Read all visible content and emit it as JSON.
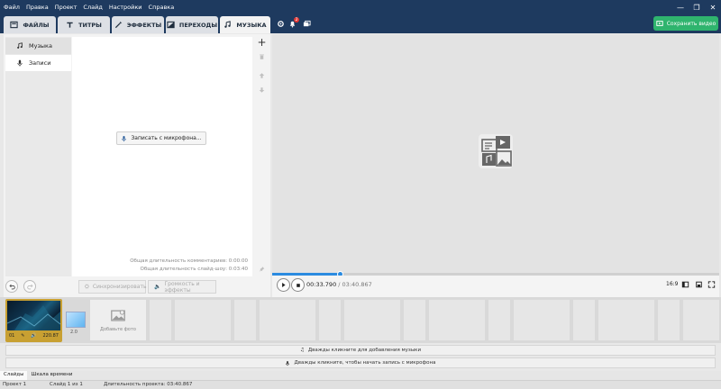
{
  "menu": [
    "Файл",
    "Правка",
    "Проект",
    "Слайд",
    "Настройки",
    "Справка"
  ],
  "tabs": {
    "files": "ФАЙЛЫ",
    "titles": "ТИТРЫ",
    "effects": "ЭФФЕКТЫ",
    "transitions": "ПЕРЕХОДЫ",
    "music": "МУЗЫКА"
  },
  "notifications_count": "2",
  "save_label": "Сохранить видео",
  "sidebar": {
    "music": "Музыка",
    "records": "Записи"
  },
  "record_button": "Записать с микрофона...",
  "durations": {
    "comments": "Общая длительность комментариев: 0:00:00",
    "slideshow": "Общая длительность слайд-шоу: 0:03:40"
  },
  "bottom_tools": {
    "sync": "Синхронизировать",
    "volume": "Громкость и эффекты"
  },
  "player": {
    "current_time": "00:33.790",
    "separator": " / ",
    "total_time": "03:40.867",
    "aspect_ratio": "16:9",
    "progress": 0.153
  },
  "timeline": {
    "slide_number": "01",
    "slide_duration": "220.87",
    "transition_duration": "2.0",
    "add_photo": "Добавьте фото",
    "music_hint": "Дважды кликните для добавления музыки",
    "mic_hint": "Дважды кликните, чтобы начать запись с микрофона"
  },
  "bottom_tabs": {
    "slides": "Слайды",
    "timeline": "Шкала времени"
  },
  "status": {
    "project": "Проект 1",
    "slide": "Слайд 1 из 1",
    "duration": "Длительность проекта: 03:40.867"
  },
  "colors": {
    "titlebar": "#1e3a5f",
    "accent": "#2b8be0",
    "save": "#2fb46e"
  }
}
